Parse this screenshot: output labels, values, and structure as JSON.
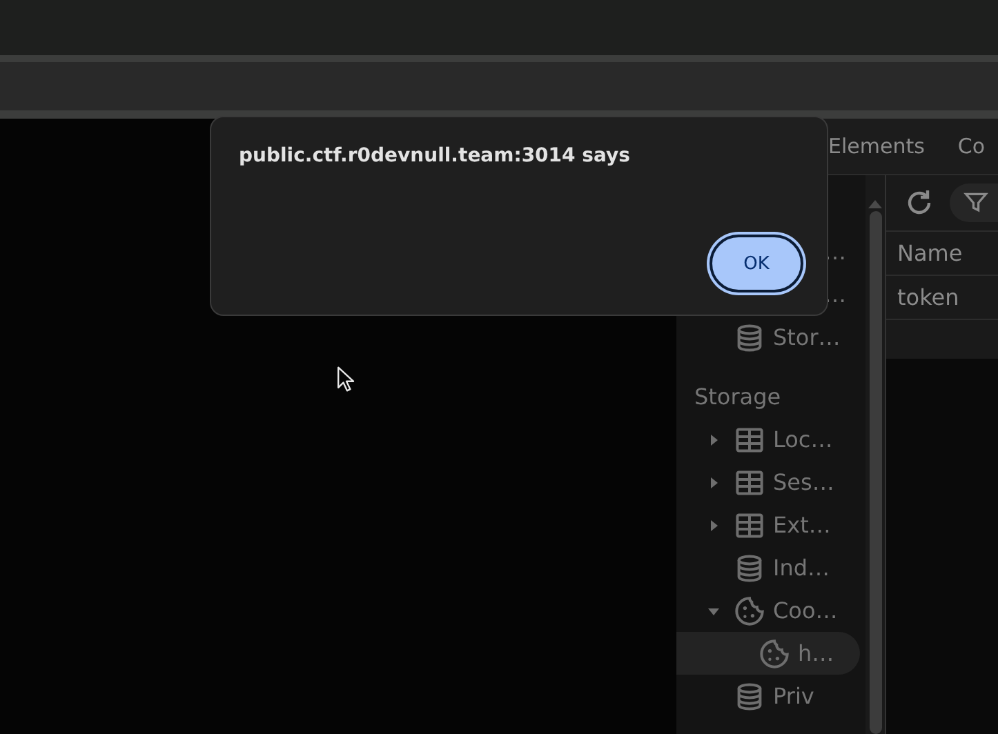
{
  "dialog": {
    "message": "public.ctf.r0devnull.team:3014 says",
    "buttons": [
      {
        "label": "OK",
        "focused": true
      }
    ]
  },
  "devtools": {
    "tabs": [
      {
        "label": "Elements",
        "selected": false
      },
      {
        "label": "Co",
        "selected": false
      }
    ],
    "sidebar": {
      "items": [
        {
          "label": "…",
          "kind": "hidden"
        },
        {
          "label": "…",
          "kind": "hidden"
        },
        {
          "label": "Stor…",
          "kind": "database",
          "selected": false
        }
      ],
      "sections": [
        {
          "title": "Storage",
          "items": [
            {
              "label": "Loc…",
              "kind": "table",
              "expanded": false,
              "selected": false
            },
            {
              "label": "Ses…",
              "kind": "table",
              "expanded": false,
              "selected": false
            },
            {
              "label": "Ext…",
              "kind": "table",
              "expanded": false,
              "selected": false
            },
            {
              "label": "Ind…",
              "kind": "database",
              "selected": false
            },
            {
              "label": "Coo…",
              "kind": "cookie",
              "expanded": true,
              "selected": false,
              "children": [
                {
                  "label": "h…",
                  "kind": "cookie",
                  "selected": true
                }
              ]
            },
            {
              "label": "Priv",
              "kind": "database",
              "selected": false
            }
          ]
        }
      ]
    },
    "table": {
      "columns": [
        "Name"
      ],
      "rows": [
        [
          "token"
        ]
      ]
    }
  }
}
